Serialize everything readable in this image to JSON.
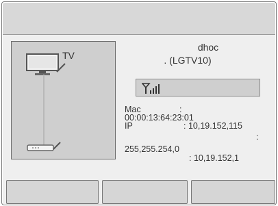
{
  "diagram": {
    "tv_label": "TV",
    "tv_icon": "tv-icon",
    "router_icon": "router-icon"
  },
  "device": {
    "name_line1": "dhoc",
    "name_line2": ". (LGTV10)"
  },
  "signal": {
    "icon": "wifi-signal-icon",
    "level": 0.8
  },
  "details": {
    "mac_label": "Mac",
    "mac_colon": ":",
    "mac_value": "00:00:13:64:23:01",
    "ip_label": "IP",
    "ip_value": ": 10,19.152,115",
    "subnet_colon": ":",
    "subnet_value": "255,255.254,0",
    "gateway_value": ": 10,19.152,1"
  },
  "buttons": [
    {
      "label": ""
    },
    {
      "label": ""
    },
    {
      "label": ""
    }
  ]
}
